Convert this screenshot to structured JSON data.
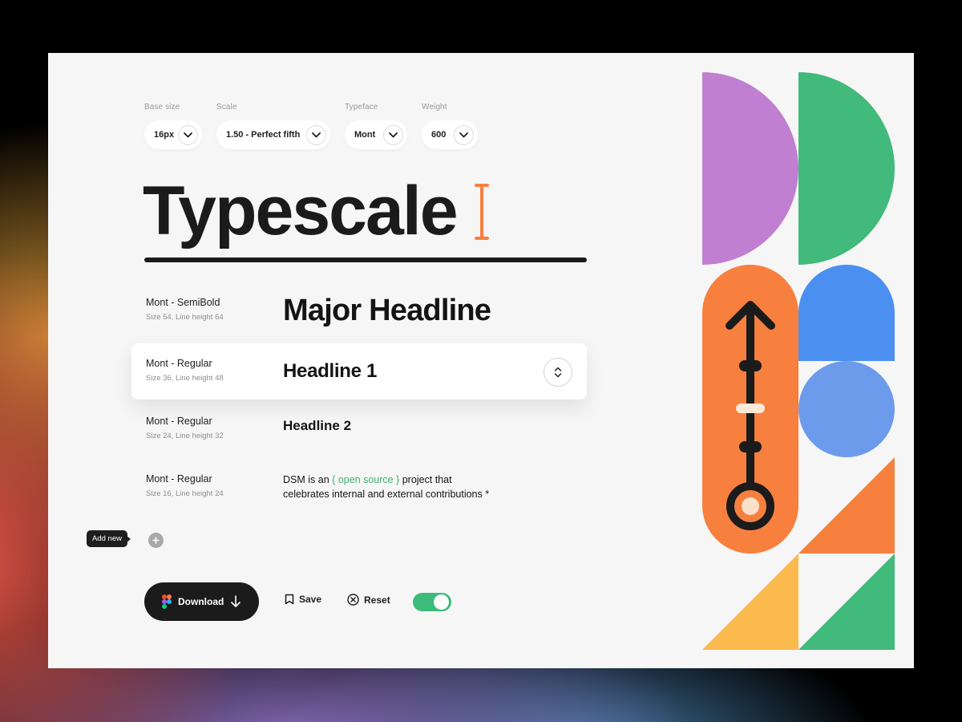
{
  "controls": {
    "base_size": {
      "label": "Base size",
      "value": "16px"
    },
    "scale": {
      "label": "Scale",
      "value": "1.50 - Perfect fifth"
    },
    "typeface": {
      "label": "Typeface",
      "value": "Mont"
    },
    "weight": {
      "label": "Weight",
      "value": "600"
    }
  },
  "title": "Typescale",
  "rows": [
    {
      "font": "Mont - SemiBold",
      "meta": "Size 54, Line height 64",
      "sample": "Major Headline"
    },
    {
      "font": "Mont - Regular",
      "meta": "Size 36, Line height 48",
      "sample": "Headline 1"
    },
    {
      "font": "Mont - Regular",
      "meta": "Size 24, Line height 32",
      "sample": "Headline 2"
    },
    {
      "font": "Mont - Regular",
      "meta": "Size 16, Line height 24",
      "sample_prefix": "DSM is an ",
      "sample_link": "{ open source }",
      "sample_suffix": " project that celebrates internal and external contributions *"
    }
  ],
  "add_new": {
    "tooltip": "Add new"
  },
  "actions": {
    "download": "Download",
    "save": "Save",
    "reset": "Reset",
    "toggle_on": true
  },
  "colors": {
    "accent_orange": "#f7803f",
    "accent_green": "#3dbb79",
    "purple": "#c07fd0",
    "blue": "#4b8ff0",
    "light_blue": "#6d9bec",
    "yellow": "#fcb94d",
    "dark": "#1b1b1b"
  }
}
